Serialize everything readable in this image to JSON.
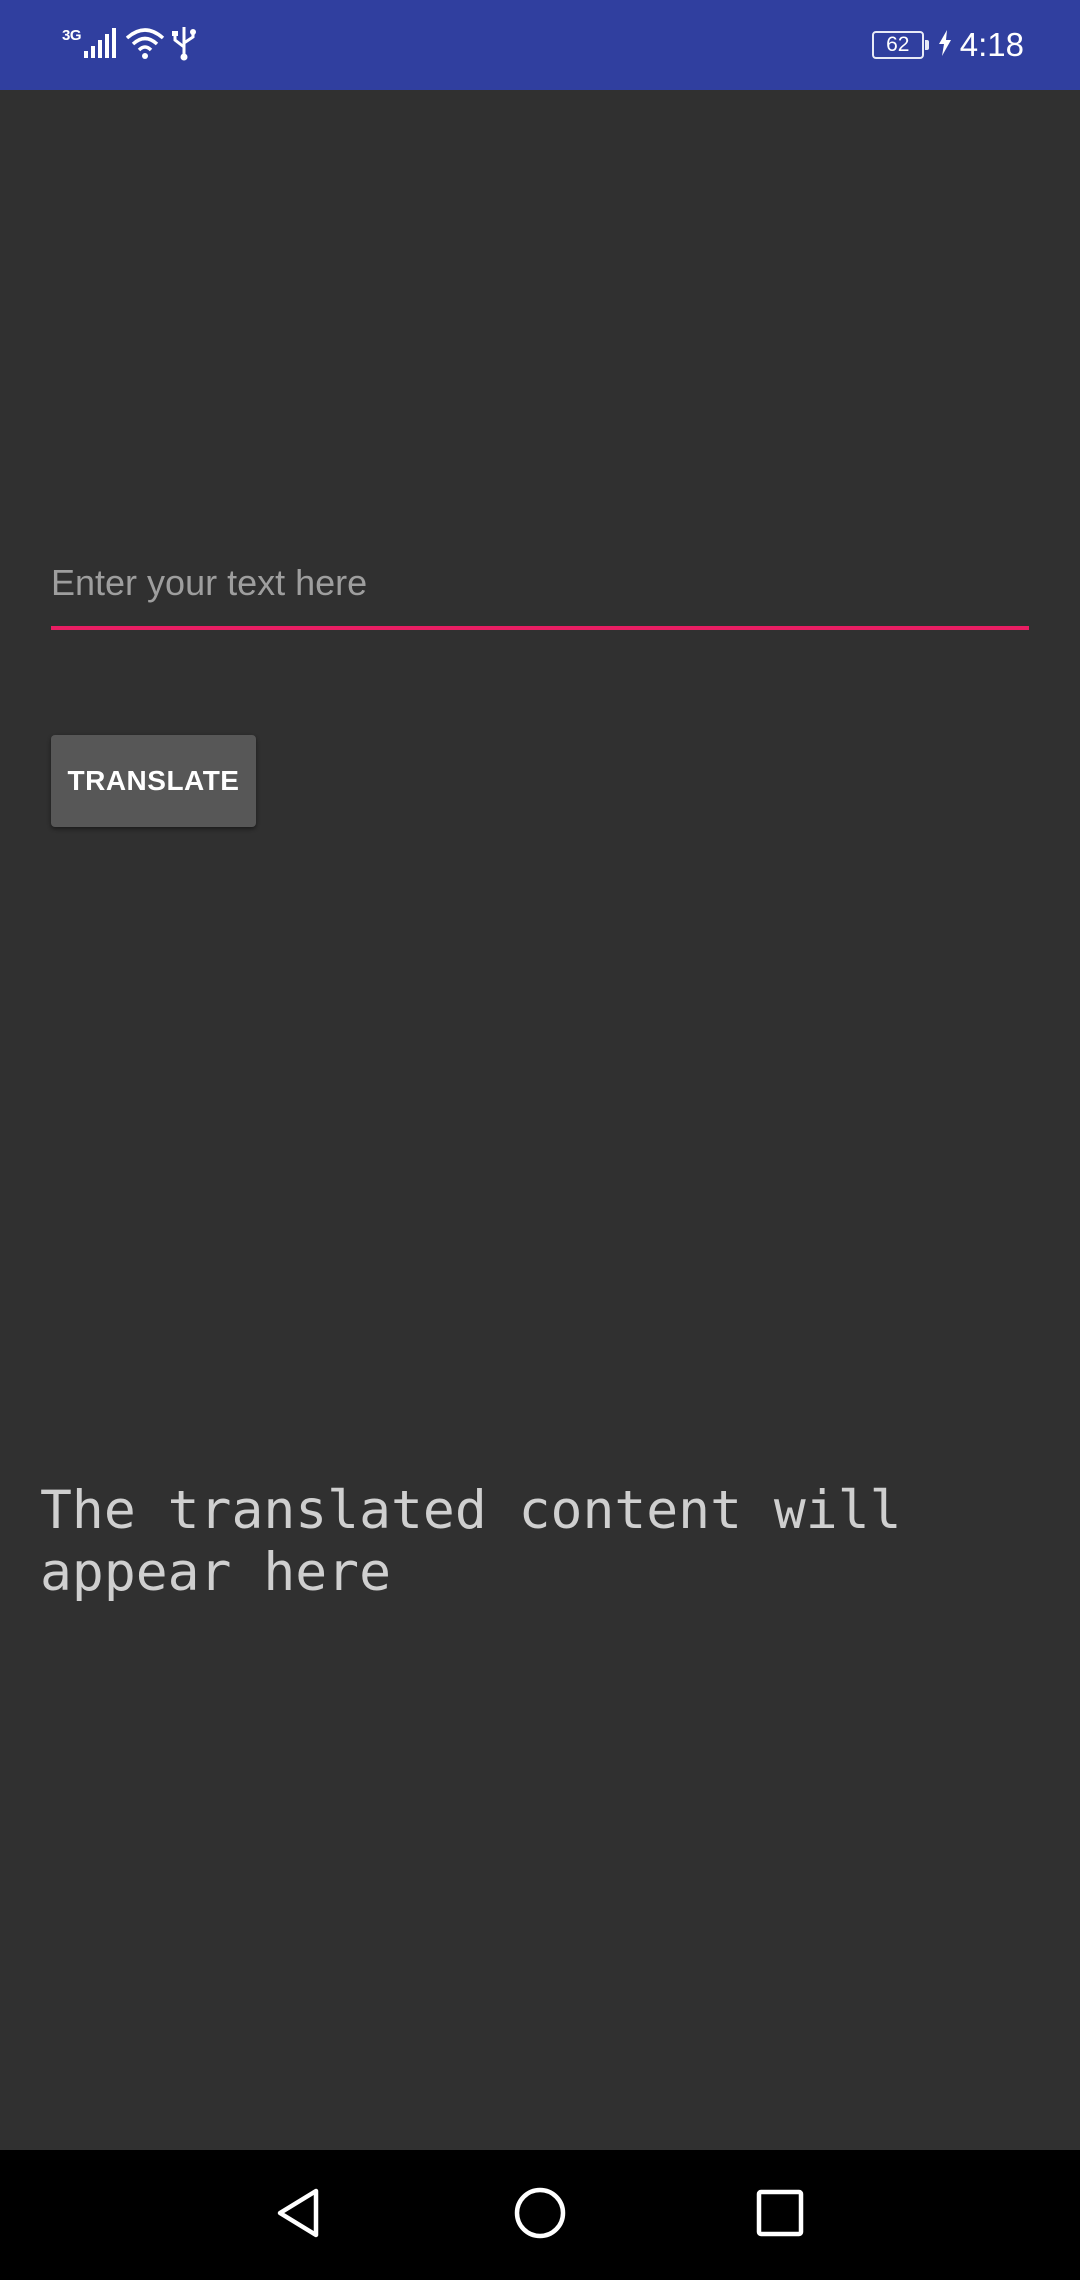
{
  "status_bar": {
    "network_type": "3G",
    "battery_level": "62",
    "time": "4:18",
    "icons": [
      "signal-icon",
      "wifi-icon",
      "usb-icon",
      "battery-icon",
      "charging-icon"
    ],
    "background_color": "#303f9f"
  },
  "input": {
    "placeholder": "Enter your text here",
    "value": "",
    "underline_color": "#e91e63"
  },
  "translate_button": {
    "label": "TRANSLATE"
  },
  "output": {
    "text": "The translated content will\nappear here"
  },
  "nav_bar": {
    "icons": [
      "back-icon",
      "home-icon",
      "recents-icon"
    ]
  }
}
